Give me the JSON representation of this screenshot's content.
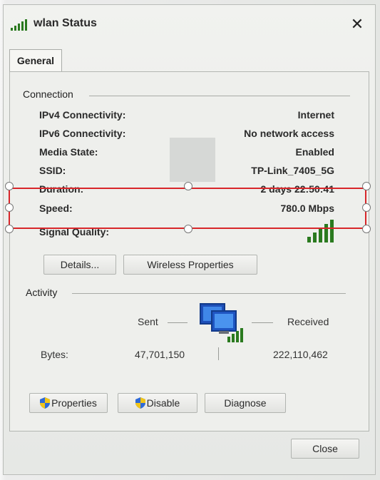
{
  "window": {
    "title": "wlan Status",
    "close_glyph": "✕",
    "icon": "signal-bars-icon"
  },
  "tabs": [
    {
      "label": "General"
    }
  ],
  "connection": {
    "title": "Connection",
    "rows": [
      {
        "label": "IPv4 Connectivity:",
        "value": "Internet"
      },
      {
        "label": "IPv6 Connectivity:",
        "value": "No network access"
      },
      {
        "label": "Media State:",
        "value": "Enabled"
      },
      {
        "label": "SSID:",
        "value": "TP-Link_7405_5G"
      },
      {
        "label": "Duration:",
        "value": "2 days 22:50:41"
      },
      {
        "label": "Speed:",
        "value": "780.0 Mbps"
      },
      {
        "label": "Signal Quality:",
        "value": ""
      }
    ],
    "buttons": {
      "details": "Details...",
      "wireless_properties": "Wireless Properties"
    }
  },
  "activity": {
    "title": "Activity",
    "sent_label": "Sent",
    "received_label": "Received",
    "bytes_label": "Bytes:",
    "bytes_sent": "47,701,150",
    "bytes_received": "222,110,462"
  },
  "actions": {
    "properties": "Properties",
    "disable": "Disable",
    "diagnose": "Diagnose"
  },
  "footer": {
    "close": "Close"
  },
  "colors": {
    "accent": "#2a7a1f",
    "selection": "#d8262a",
    "shield_blue": "#2f6ad6",
    "shield_yellow": "#f0c419"
  },
  "signal_quality": {
    "level_fraction": 1.0
  }
}
